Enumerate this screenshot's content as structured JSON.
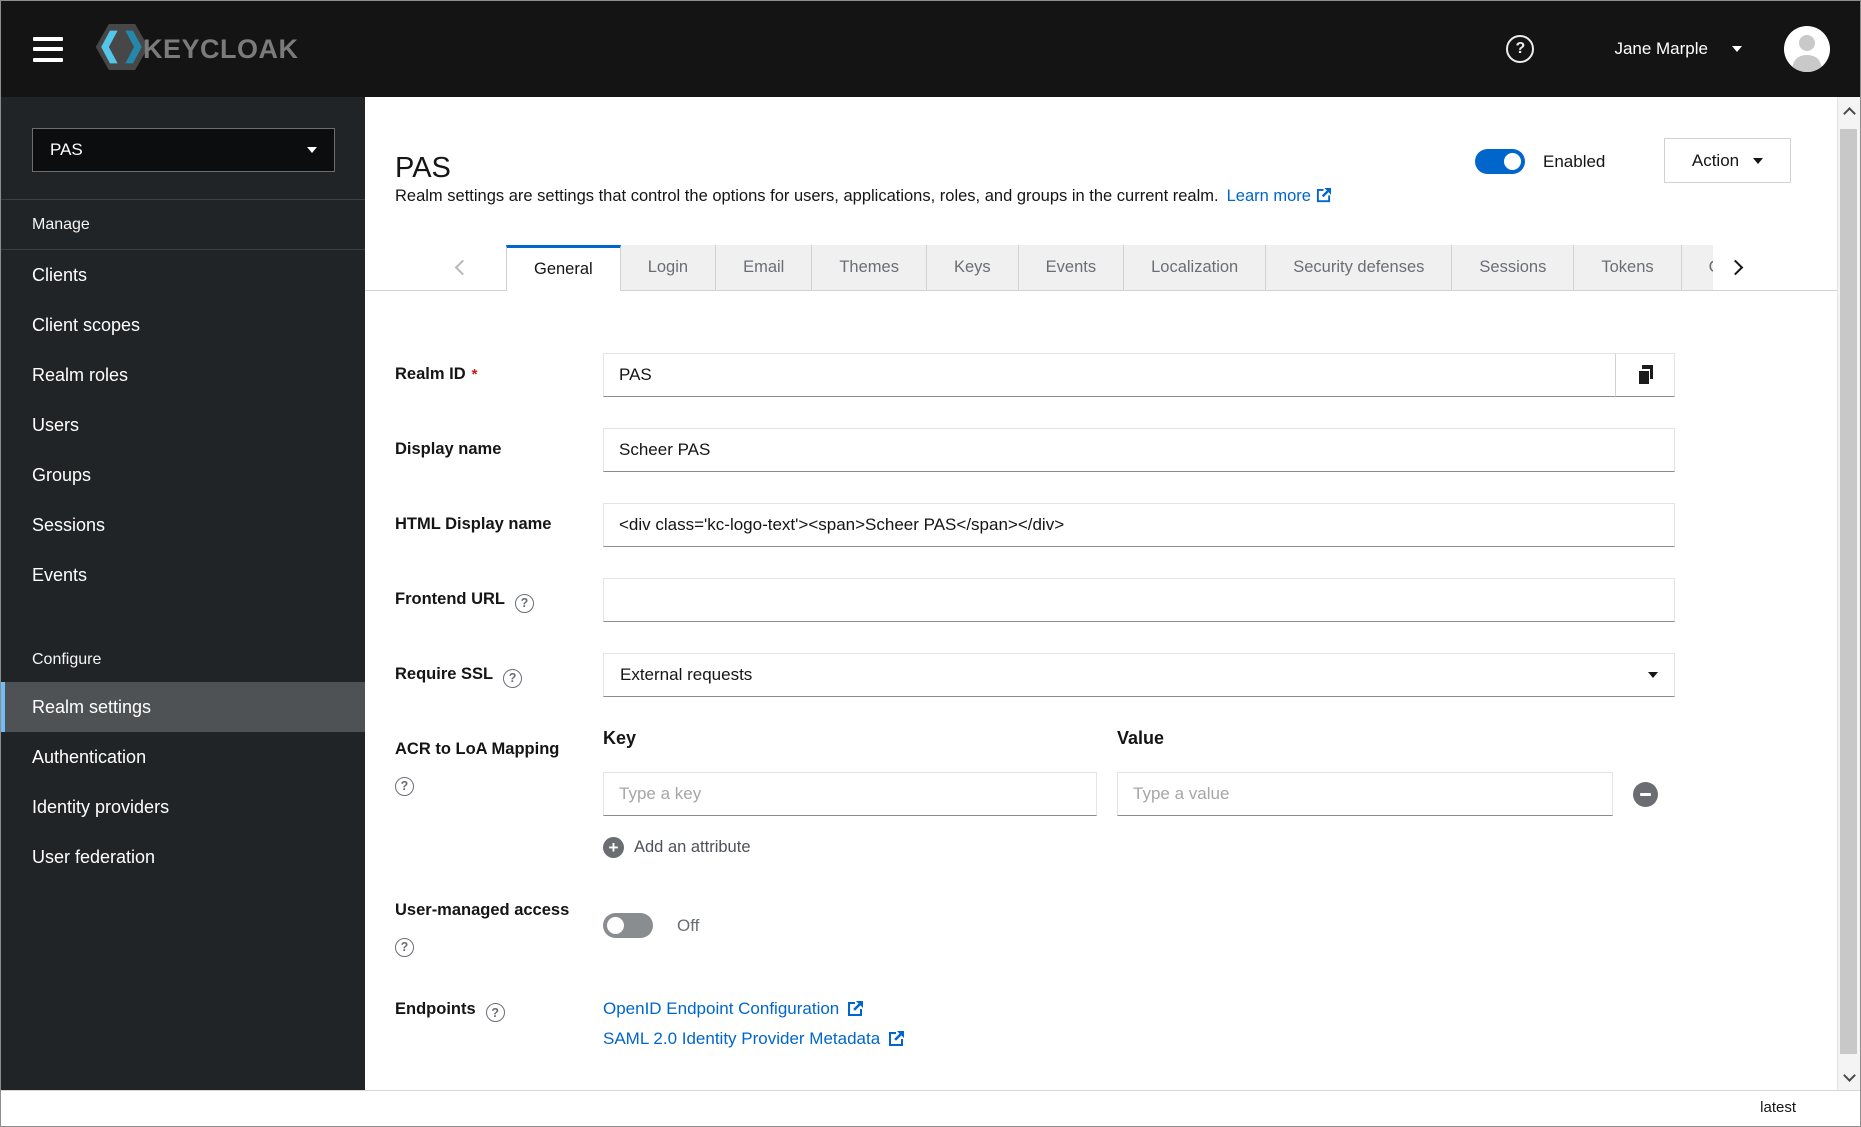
{
  "topbar": {
    "brand": "KEYCLOAK",
    "user": "Jane Marple"
  },
  "sidebar": {
    "realm": "PAS",
    "manage_heading": "Manage",
    "manage_items": [
      "Clients",
      "Client scopes",
      "Realm roles",
      "Users",
      "Groups",
      "Sessions",
      "Events"
    ],
    "configure_heading": "Configure",
    "configure_items": [
      "Realm settings",
      "Authentication",
      "Identity providers",
      "User federation"
    ]
  },
  "header": {
    "title": "PAS",
    "description": "Realm settings are settings that control the options for users, applications, roles, and groups in the current realm.",
    "learn_more": "Learn more",
    "enabled_label": "Enabled",
    "action_label": "Action"
  },
  "tabs": [
    "General",
    "Login",
    "Email",
    "Themes",
    "Keys",
    "Events",
    "Localization",
    "Security defenses",
    "Sessions",
    "Tokens",
    "Cli"
  ],
  "form": {
    "realm_id": {
      "label": "Realm ID",
      "required_indicator": "*",
      "value": "PAS"
    },
    "display_name": {
      "label": "Display name",
      "value": "Scheer PAS"
    },
    "html_display_name": {
      "label": "HTML Display name",
      "value": "<div class='kc-logo-text'><span>Scheer PAS</span></div>"
    },
    "frontend_url": {
      "label": "Frontend URL",
      "value": ""
    },
    "require_ssl": {
      "label": "Require SSL",
      "value": "External requests"
    },
    "acr_mapping": {
      "label": "ACR to LoA Mapping",
      "key_header": "Key",
      "value_header": "Value",
      "key_placeholder": "Type a key",
      "value_placeholder": "Type a value",
      "add_label": "Add an attribute"
    },
    "user_managed_access": {
      "label": "User-managed access",
      "state": "Off"
    },
    "endpoints": {
      "label": "Endpoints",
      "links": [
        "OpenID Endpoint Configuration",
        "SAML 2.0 Identity Provider Metadata"
      ]
    }
  },
  "footer": {
    "version": "latest"
  },
  "colors": {
    "accent": "#0066cc",
    "link": "#0066cc",
    "masthead": "#141414",
    "sidebar": "#212427",
    "nav_selected": "#4f5255",
    "nav_indicator": "#73bcf7",
    "tab_inactive_bg": "#f0f0f0",
    "border": "#d2d2d2",
    "input_border_bottom": "#8a8d90",
    "danger": "#c9190b",
    "text": "#151515",
    "muted": "#6a6e73",
    "toggle_off": "#8a8d90"
  }
}
